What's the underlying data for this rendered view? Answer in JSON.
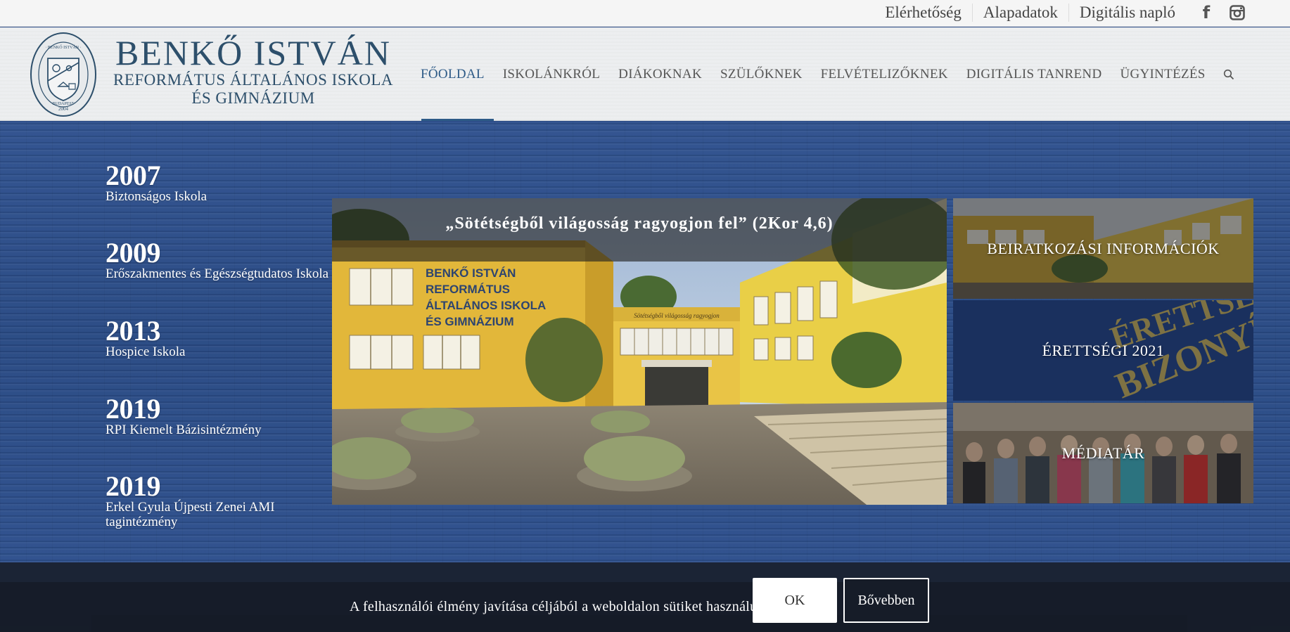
{
  "topbar": {
    "links": [
      "Elérhetőség",
      "Alapadatok",
      "Digitális napló"
    ],
    "social_icons": [
      "facebook-icon",
      "instagram-icon"
    ]
  },
  "logo": {
    "line1": "BENKŐ ISTVÁN",
    "line2": "REFORMÁTUS ÁLTALÁNOS ISKOLA",
    "line3": "ÉS GIMNÁZIUM"
  },
  "nav": {
    "items": [
      "FŐOLDAL",
      "ISKOLÁNKRÓL",
      "DIÁKOKNAK",
      "SZÜLŐKNEK",
      "FELVÉTELIZŐKNEK",
      "DIGITÁLIS TANREND",
      "ÜGYINTÉZÉS"
    ],
    "active": "FŐOLDAL"
  },
  "milestones": [
    {
      "year": "2007",
      "text": "Biztonságos Iskola"
    },
    {
      "year": "2009",
      "text": "Erőszakmentes és Egészségtudatos Iskola"
    },
    {
      "year": "2013",
      "text": "Hospice Iskola"
    },
    {
      "year": "2019",
      "text": "RPI Kiemelt Bázisintézmény"
    },
    {
      "year": "2019",
      "text": "Erkel Gyula Újpesti Zenei AMI tagintézmény"
    }
  ],
  "hero": {
    "caption": "„Sötétségből világosság ragyogjon fel” (2Kor 4,6)",
    "building_sign": [
      "BENKŐ ISTVÁN",
      "REFORMÁTUS",
      "ÁLTALÁNOS ISKOLA",
      "ÉS GIMNÁZIUM"
    ],
    "entrance_sign": "Sötétségből világosság ragyogjon"
  },
  "tiles": [
    {
      "label": "BEIRATKOZÁSI INFORMÁCIÓK"
    },
    {
      "label": "ÉRETTSÉGI 2021",
      "bg_text": [
        "ÉRETTSÉGI",
        "BIZONYÍTVÁNY"
      ]
    },
    {
      "label": "MÉDIATÁR"
    }
  ],
  "cookie": {
    "text": "A felhasználói élmény javítása céljából a weboldalon sütiket használunk.",
    "ok_label": "OK",
    "more_label": "Bővebben"
  },
  "colors": {
    "brand_blue": "#2d5a87",
    "background_blue": "#2c4d8a",
    "footer_dark": "#1b2435"
  }
}
